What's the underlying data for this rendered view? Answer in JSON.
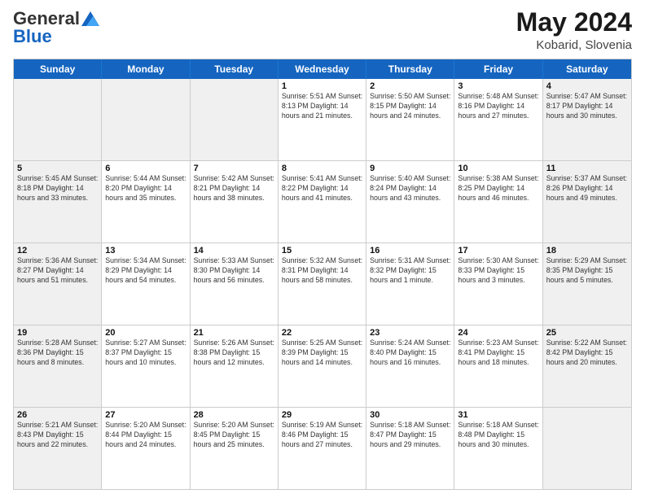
{
  "header": {
    "logo_general": "General",
    "logo_blue": "Blue",
    "month": "May 2024",
    "location": "Kobarid, Slovenia"
  },
  "weekdays": [
    "Sunday",
    "Monday",
    "Tuesday",
    "Wednesday",
    "Thursday",
    "Friday",
    "Saturday"
  ],
  "rows": [
    [
      {
        "day": "",
        "text": "",
        "shaded": true
      },
      {
        "day": "",
        "text": "",
        "shaded": true
      },
      {
        "day": "",
        "text": "",
        "shaded": true
      },
      {
        "day": "1",
        "text": "Sunrise: 5:51 AM\nSunset: 8:13 PM\nDaylight: 14 hours\nand 21 minutes."
      },
      {
        "day": "2",
        "text": "Sunrise: 5:50 AM\nSunset: 8:15 PM\nDaylight: 14 hours\nand 24 minutes."
      },
      {
        "day": "3",
        "text": "Sunrise: 5:48 AM\nSunset: 8:16 PM\nDaylight: 14 hours\nand 27 minutes."
      },
      {
        "day": "4",
        "text": "Sunrise: 5:47 AM\nSunset: 8:17 PM\nDaylight: 14 hours\nand 30 minutes.",
        "shaded": true
      }
    ],
    [
      {
        "day": "5",
        "text": "Sunrise: 5:45 AM\nSunset: 8:18 PM\nDaylight: 14 hours\nand 33 minutes.",
        "shaded": true
      },
      {
        "day": "6",
        "text": "Sunrise: 5:44 AM\nSunset: 8:20 PM\nDaylight: 14 hours\nand 35 minutes."
      },
      {
        "day": "7",
        "text": "Sunrise: 5:42 AM\nSunset: 8:21 PM\nDaylight: 14 hours\nand 38 minutes."
      },
      {
        "day": "8",
        "text": "Sunrise: 5:41 AM\nSunset: 8:22 PM\nDaylight: 14 hours\nand 41 minutes."
      },
      {
        "day": "9",
        "text": "Sunrise: 5:40 AM\nSunset: 8:24 PM\nDaylight: 14 hours\nand 43 minutes."
      },
      {
        "day": "10",
        "text": "Sunrise: 5:38 AM\nSunset: 8:25 PM\nDaylight: 14 hours\nand 46 minutes."
      },
      {
        "day": "11",
        "text": "Sunrise: 5:37 AM\nSunset: 8:26 PM\nDaylight: 14 hours\nand 49 minutes.",
        "shaded": true
      }
    ],
    [
      {
        "day": "12",
        "text": "Sunrise: 5:36 AM\nSunset: 8:27 PM\nDaylight: 14 hours\nand 51 minutes.",
        "shaded": true
      },
      {
        "day": "13",
        "text": "Sunrise: 5:34 AM\nSunset: 8:29 PM\nDaylight: 14 hours\nand 54 minutes."
      },
      {
        "day": "14",
        "text": "Sunrise: 5:33 AM\nSunset: 8:30 PM\nDaylight: 14 hours\nand 56 minutes."
      },
      {
        "day": "15",
        "text": "Sunrise: 5:32 AM\nSunset: 8:31 PM\nDaylight: 14 hours\nand 58 minutes."
      },
      {
        "day": "16",
        "text": "Sunrise: 5:31 AM\nSunset: 8:32 PM\nDaylight: 15 hours\nand 1 minute."
      },
      {
        "day": "17",
        "text": "Sunrise: 5:30 AM\nSunset: 8:33 PM\nDaylight: 15 hours\nand 3 minutes."
      },
      {
        "day": "18",
        "text": "Sunrise: 5:29 AM\nSunset: 8:35 PM\nDaylight: 15 hours\nand 5 minutes.",
        "shaded": true
      }
    ],
    [
      {
        "day": "19",
        "text": "Sunrise: 5:28 AM\nSunset: 8:36 PM\nDaylight: 15 hours\nand 8 minutes.",
        "shaded": true
      },
      {
        "day": "20",
        "text": "Sunrise: 5:27 AM\nSunset: 8:37 PM\nDaylight: 15 hours\nand 10 minutes."
      },
      {
        "day": "21",
        "text": "Sunrise: 5:26 AM\nSunset: 8:38 PM\nDaylight: 15 hours\nand 12 minutes."
      },
      {
        "day": "22",
        "text": "Sunrise: 5:25 AM\nSunset: 8:39 PM\nDaylight: 15 hours\nand 14 minutes."
      },
      {
        "day": "23",
        "text": "Sunrise: 5:24 AM\nSunset: 8:40 PM\nDaylight: 15 hours\nand 16 minutes."
      },
      {
        "day": "24",
        "text": "Sunrise: 5:23 AM\nSunset: 8:41 PM\nDaylight: 15 hours\nand 18 minutes."
      },
      {
        "day": "25",
        "text": "Sunrise: 5:22 AM\nSunset: 8:42 PM\nDaylight: 15 hours\nand 20 minutes.",
        "shaded": true
      }
    ],
    [
      {
        "day": "26",
        "text": "Sunrise: 5:21 AM\nSunset: 8:43 PM\nDaylight: 15 hours\nand 22 minutes.",
        "shaded": true
      },
      {
        "day": "27",
        "text": "Sunrise: 5:20 AM\nSunset: 8:44 PM\nDaylight: 15 hours\nand 24 minutes."
      },
      {
        "day": "28",
        "text": "Sunrise: 5:20 AM\nSunset: 8:45 PM\nDaylight: 15 hours\nand 25 minutes."
      },
      {
        "day": "29",
        "text": "Sunrise: 5:19 AM\nSunset: 8:46 PM\nDaylight: 15 hours\nand 27 minutes."
      },
      {
        "day": "30",
        "text": "Sunrise: 5:18 AM\nSunset: 8:47 PM\nDaylight: 15 hours\nand 29 minutes."
      },
      {
        "day": "31",
        "text": "Sunrise: 5:18 AM\nSunset: 8:48 PM\nDaylight: 15 hours\nand 30 minutes."
      },
      {
        "day": "",
        "text": "",
        "shaded": true
      }
    ]
  ]
}
